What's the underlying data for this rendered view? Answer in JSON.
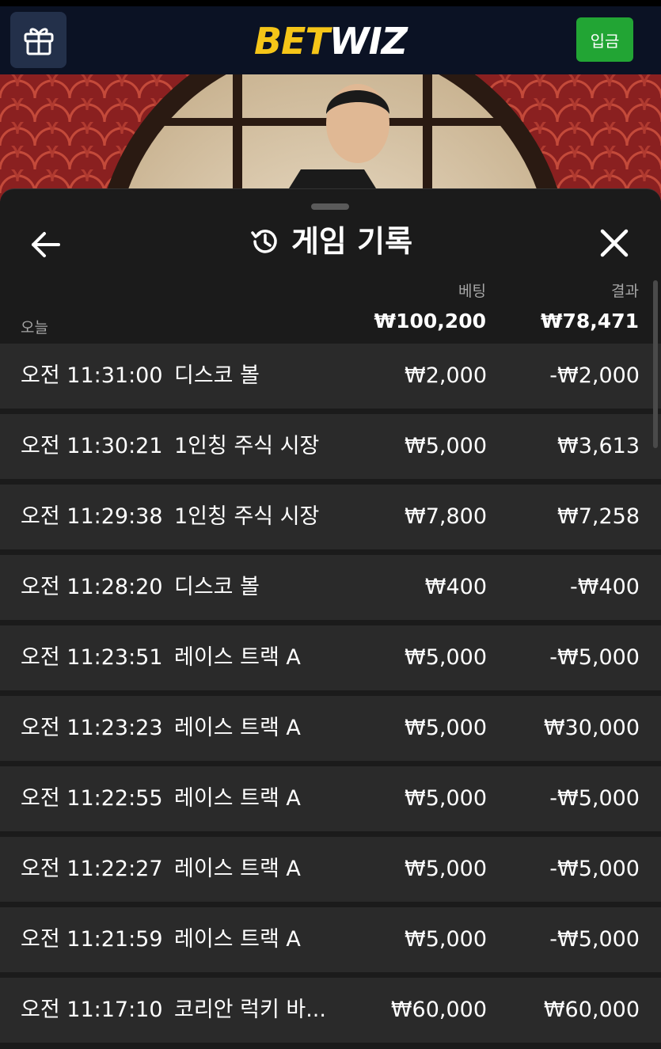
{
  "header": {
    "logo_bet": "BET",
    "logo_wiz": "WIZ",
    "deposit_label": "입금"
  },
  "sheet": {
    "title": "게임 기록",
    "columns": {
      "bet": "베팅",
      "result": "결과"
    },
    "day_label": "오늘",
    "total_bet": "₩100,200",
    "total_result": "₩78,471"
  },
  "rows": [
    {
      "time": "오전 11:31:00",
      "game": "디스코 볼",
      "bet": "₩2,000",
      "result": "-₩2,000"
    },
    {
      "time": "오전 11:30:21",
      "game": "1인칭 주식 시장",
      "bet": "₩5,000",
      "result": "₩3,613"
    },
    {
      "time": "오전 11:29:38",
      "game": "1인칭 주식 시장",
      "bet": "₩7,800",
      "result": "₩7,258"
    },
    {
      "time": "오전 11:28:20",
      "game": "디스코 볼",
      "bet": "₩400",
      "result": "-₩400"
    },
    {
      "time": "오전 11:23:51",
      "game": "레이스 트랙 A",
      "bet": "₩5,000",
      "result": "-₩5,000"
    },
    {
      "time": "오전 11:23:23",
      "game": "레이스 트랙 A",
      "bet": "₩5,000",
      "result": "₩30,000"
    },
    {
      "time": "오전 11:22:55",
      "game": "레이스 트랙 A",
      "bet": "₩5,000",
      "result": "-₩5,000"
    },
    {
      "time": "오전 11:22:27",
      "game": "레이스 트랙 A",
      "bet": "₩5,000",
      "result": "-₩5,000"
    },
    {
      "time": "오전 11:21:59",
      "game": "레이스 트랙 A",
      "bet": "₩5,000",
      "result": "-₩5,000"
    },
    {
      "time": "오전 11:17:10",
      "game": "코리안 럭키 바...",
      "bet": "₩60,000",
      "result": "₩60,000"
    }
  ]
}
